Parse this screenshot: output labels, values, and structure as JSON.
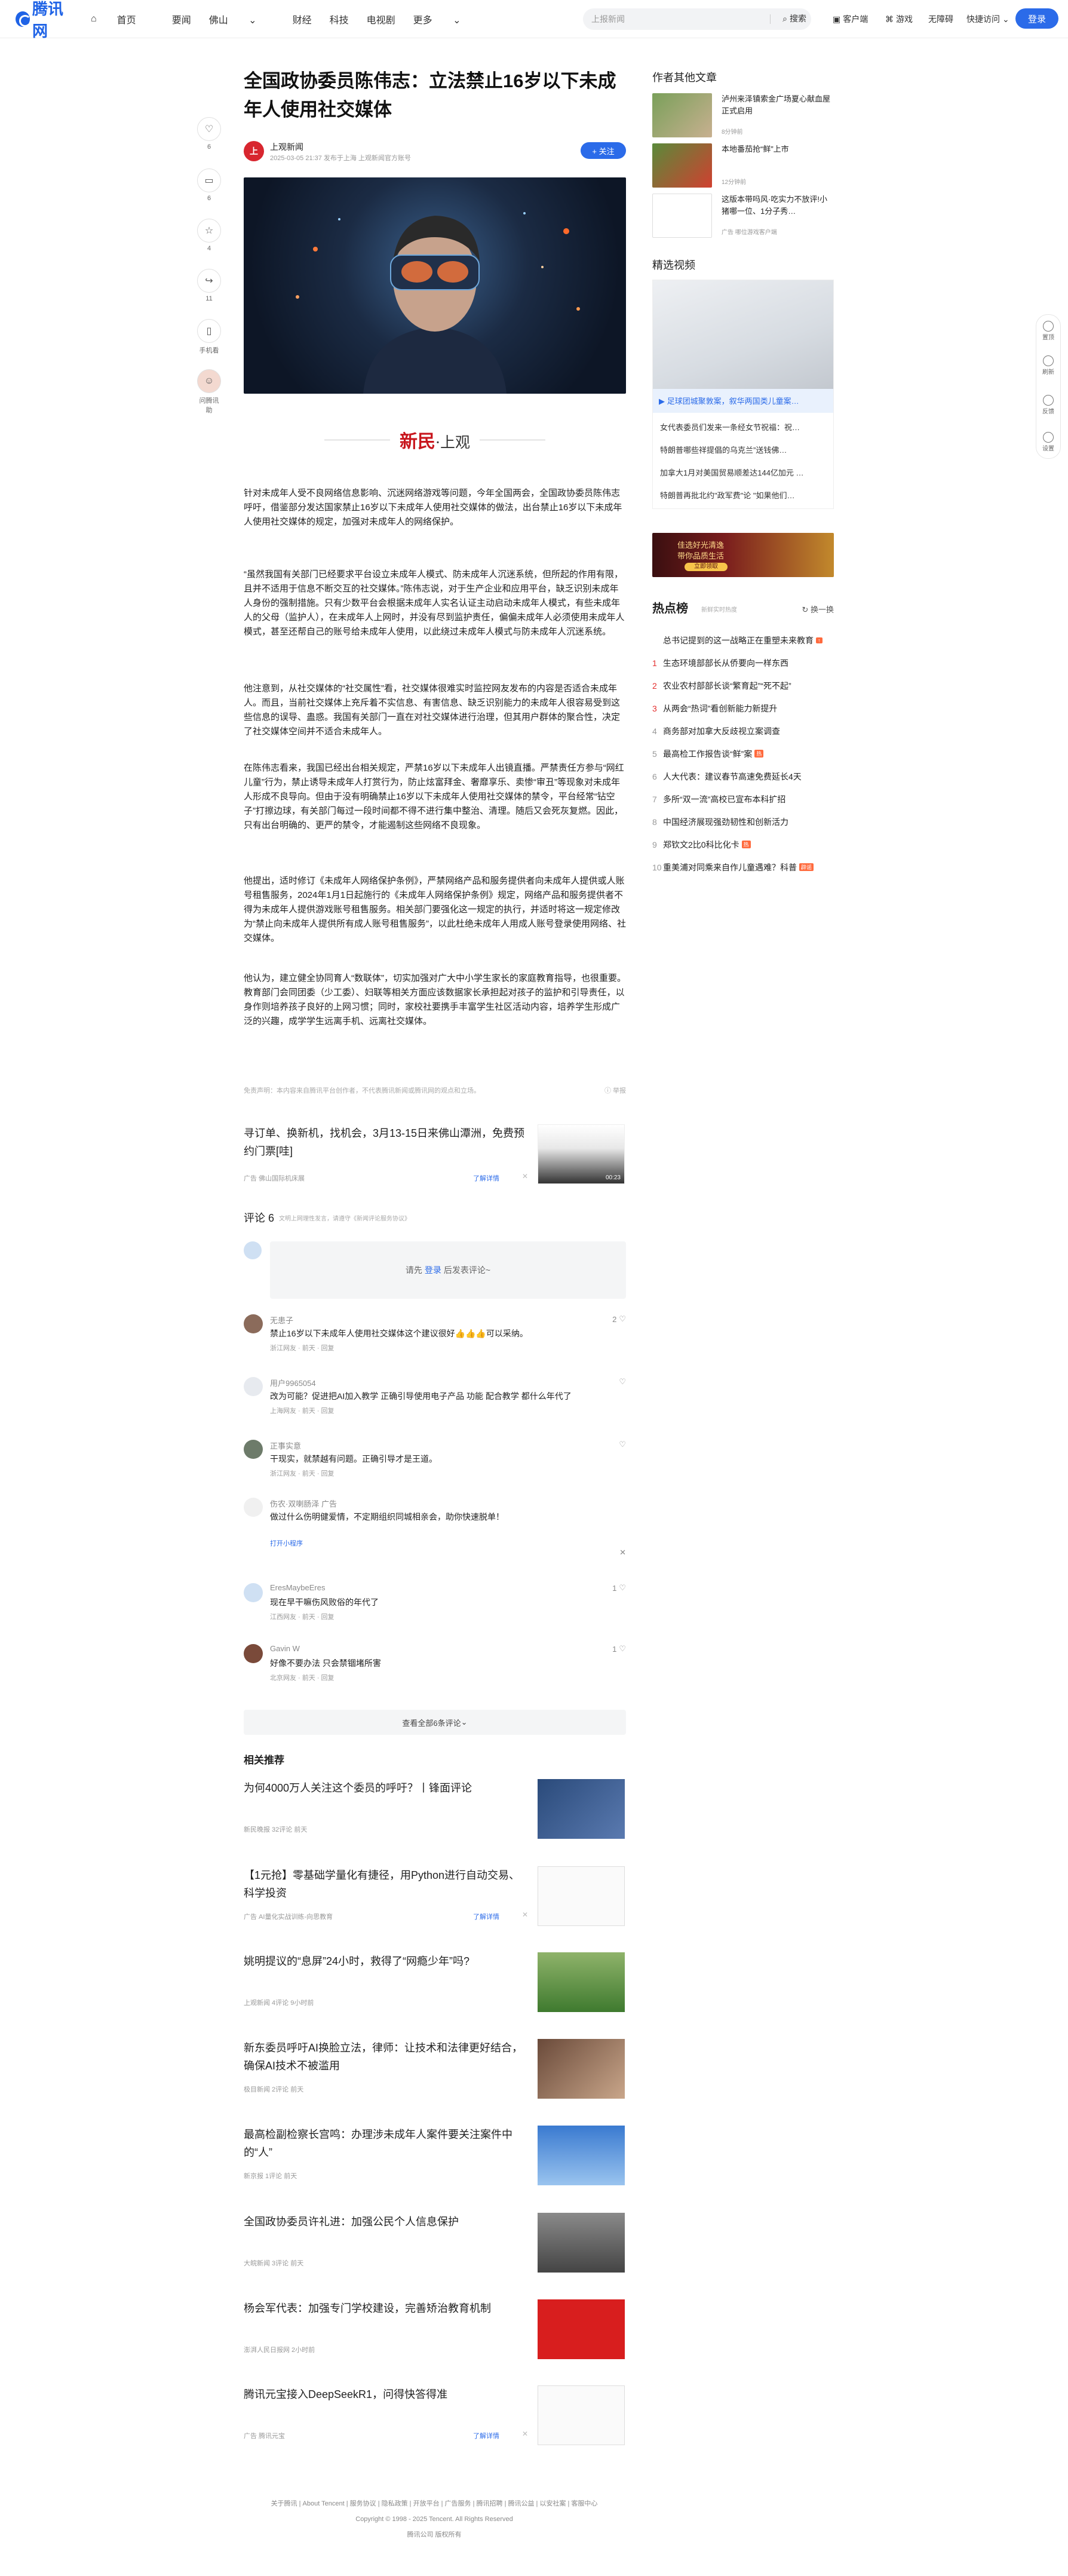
{
  "header": {
    "logo": "腾讯网",
    "nav": [
      "首页",
      "要闻",
      "佛山",
      "财经",
      "科技",
      "电视剧",
      "更多"
    ],
    "search_placeholder": "上报新闻",
    "search_btn": "搜索",
    "tools": [
      "客户端",
      "游戏",
      "无障碍",
      "快捷访问"
    ],
    "login": "登录"
  },
  "share": {
    "items": [
      {
        "icon": "heart-icon",
        "count": "6"
      },
      {
        "icon": "comment-icon",
        "count": "6"
      },
      {
        "icon": "star-icon",
        "count": "4"
      },
      {
        "icon": "share-icon",
        "count": "11"
      },
      {
        "icon": "phone-icon",
        "count": "手机看"
      },
      {
        "icon": "ai-avatar-icon",
        "count": "问腾讯助"
      }
    ]
  },
  "article": {
    "title": "全国政协委员陈伟志：立法禁止16岁以下未成年人使用社交媒体",
    "author": "上观新闻",
    "meta": "2025-03-05 21:37  发布于上海  上观新闻官方账号",
    "follow": "+ 关注",
    "brand_red": "新民",
    "brand_dot": "·上观",
    "paragraphs": [
      "针对未成年人受不良网络信息影响、沉迷网络游戏等问题，今年全国两会，全国政协委员陈伟志呼吁，借鉴部分发达国家禁止16岁以下未成年人使用社交媒体的做法，出台禁止16岁以下未成年人使用社交媒体的规定，加强对未成年人的网络保护。",
      "“虽然我国有关部门已经要求平台设立未成年人模式、防未成年人沉迷系统，但所起的作用有限，且并不适用于信息不断交互的社交媒体。”陈伟志说，对于生产企业和应用平台，缺乏识别未成年人身份的强制措施。只有少数平台会根据未成年人实名认证主动启动未成年人模式，有些未成年人的父母（监护人），在未成年人上网时，并没有尽到监护责任，偏偏未成年人必须使用未成年人模式，甚至还帮自己的账号给未成年人使用，以此绕过未成年人模式与防未成年人沉迷系统。",
      "他注意到，从社交媒体的“社交属性”看，社交媒体很难实时监控网友发布的内容是否适合未成年人。而且，当前社交媒体上充斥着不实信息、有害信息、缺乏识别能力的未成年人很容易受到这些信息的误导、蛊惑。我国有关部门一直在对社交媒体进行治理，但其用户群体的聚合性，决定了社交媒体空间并不适合未成年人。",
      "在陈伟志看来，我国已经出台相关规定，严禁16岁以下未成年人出镜直播。严禁责任方参与“网红儿童”行为，禁止诱导未成年人打赏行为，防止炫富拜金、奢靡享乐、卖惨“审丑”等现象对未成年人形成不良导向。但由于没有明确禁止16岁以下未成年人使用社交媒体的禁令，平台经常“钻空子”打擦边球，有关部门每过一段时间都不得不进行集中整治、清理。随后又会死灰复燃。因此，只有出台明确的、更严的禁令，才能遏制这些网络不良现象。",
      "他提出，适时修订《未成年人网络保护条例》，严禁网络产品和服务提供者向未成年人提供或人账号租售服务，2024年1月1日起施行的《未成年人网络保护条例》规定，网络产品和服务提供者不得为未成年人提供游戏账号租售服务。相关部门要强化这一规定的执行，并适时将这一规定修改为“禁止向未成年人提供所有成人账号租售服务”，以此杜绝未成年人用成人账号登录使用网络、社交媒体。",
      "他认为，建立健全协同育人“数联体”，切实加强对广大中小学生家长的家庭教育指导，也很重要。教育部门会同团委（少工委）、妇联等相关方面应该数据家长承担起对孩子的监护和引导责任，以身作则培养孩子良好的上网习惯；同时，家校社要携手丰富学生社区活动内容，培养学生形成广泛的兴趣，成学学生远离手机、远离社交媒体。"
    ],
    "disclaimer": "免责声明：本内容来自腾讯平台创作者，不代表腾讯新闻或腾讯网的观点和立场。",
    "report": "举报"
  },
  "ad": {
    "title": "寻订单、换新机，找机会，3月13-15日来佛山潭洲，免费预约门票[哇]",
    "meta": "广告  佛山国际机床展",
    "link": "了解详情",
    "duration": "00:23"
  },
  "comments": {
    "label": "评论 6",
    "sub": "文明上网理性发言，请遵守《新闻评论服务协议》",
    "login_prompt_a": "请先",
    "login_prompt_b": "登录",
    "login_prompt_c": "后发表评论~",
    "items": [
      {
        "name": "无患子",
        "text": "禁止16岁以下未成年人使用社交媒体这个建议很好👍👍👍可以采纳。",
        "meta": "浙江网友 · 前天 · 回复",
        "likes": "2"
      },
      {
        "name": "用户9965054",
        "text": "改为可能？促进把AI加入教学 正确引导使用电子产品 功能 配合教学 都什么年代了",
        "meta": "上海网友 · 前天 · 回复",
        "likes": ""
      },
      {
        "name": "正事实意",
        "text": "干现实，就禁越有问题。正确引导才是王道。",
        "meta": "浙江网友 · 前天 · 回复",
        "likes": ""
      },
      {
        "name": "伤农·双喇肠泽  广告",
        "text": "做过什么伤明健爱情，不定期组织同城相亲会，助你快速脱单！",
        "meta": "打开小程序",
        "likes": ""
      },
      {
        "name": "EresMaybeEres",
        "text": "现在早干嘛伤风败俗的年代了",
        "meta": "江西网友 · 前天 · 回复",
        "likes": "1"
      },
      {
        "name": "Gavin W",
        "text": "好像不要办法 只会禁锢堵所害",
        "meta": "北京网友 · 前天 · 回复",
        "likes": "1"
      }
    ],
    "more": "查看全部6条评论"
  },
  "related": {
    "head": "相关推荐",
    "items": [
      {
        "title": "为何4000万人关注这个委员的呼吁？丨锋面评论",
        "meta": "新民晚报  32评论  前天",
        "ad": false
      },
      {
        "title": "【1元抢】零基础学量化有捷径，用Python进行自动交易、科学投资",
        "meta": "广告  AI量化实战训练-向思教育",
        "ad": true
      },
      {
        "title": "姚明提议的“息屏”24小时，救得了“网瘾少年”吗?",
        "meta": "上观新闻  4评论  9小时前",
        "ad": false
      },
      {
        "title": "新东委员呼吁AI换脸立法，律师：让技术和法律更好结合，确保AI技术不被滥用",
        "meta": "极目新闻  2评论  前天",
        "ad": false
      },
      {
        "title": "最高检副检察长宫鸣：办理涉未成年人案件要关注案件中的“人”",
        "meta": "新京报  1评论  前天",
        "ad": false
      },
      {
        "title": "全国政协委员许礼进：加强公民个人信息保护",
        "meta": "大皖新闻  3评论  前天",
        "ad": false
      },
      {
        "title": "杨会军代表：加强专门学校建设，完善矫治教育机制",
        "meta": "澎湃人民日报网  2小时前",
        "ad": false
      },
      {
        "title": "腾讯元宝接入DeepSeekR1，问得快答得准",
        "meta": "广告  腾讯元宝",
        "ad": true
      }
    ],
    "ad_link": "了解详情"
  },
  "footer": {
    "links": "关于腾讯 | About Tencent | 服务协议 | 隐私政策 | 开放平台 | 广告服务 | 腾讯招聘 | 腾讯公益 | 以安社案 | 客服中心",
    "copyright": "Copyright © 1998 - 2025 Tencent. All Rights Reserved",
    "record": "腾讯公司 版权所有"
  },
  "sidebar": {
    "author_head": "作者其他文章",
    "author_articles": [
      {
        "title": "泸州来泽镇索金广场夏心献血屋正式启用",
        "meta": "8分钟前"
      },
      {
        "title": "本地番茄抢“鲜”上市",
        "meta": "12分钟前"
      },
      {
        "title": "这版本带吗风·吃实力不放评!小猪哪一位、1分子秀…",
        "meta": "广告  哪位游戏客户端"
      }
    ],
    "video_head": "精选视频",
    "video_caption": "▶ 足球团城聚敦案，叙华两国类儿童案…",
    "video_list": [
      "女代表委员们发来一条经女节祝福：祝…",
      "特朗普哪些祥提倡的乌克兰”送钱佛…",
      "加拿大1月对美国贸易顺差达144亿加元 …",
      "特朗普再批北约\"政军费\"论 \"如果他们…"
    ],
    "hot_ad_l1": "佳选好光清逸",
    "hot_ad_l2": "带你品质生活",
    "hot_ad_btn": "立即领取",
    "hot_head": "热点榜",
    "hot_sub": "新鲜实时热度",
    "hot_refresh": "换一换",
    "hot_items": [
      {
        "rank": "",
        "text": "总书记提到的这一战略正在重塑未来教育",
        "tag": "↑"
      },
      {
        "rank": "1",
        "text": "生态环境部部长从侨要向一样东西",
        "tag": ""
      },
      {
        "rank": "2",
        "text": "农业农村部部长谈“繁育起”“死不起”",
        "tag": ""
      },
      {
        "rank": "3",
        "text": "从两会“热词”看创新能力新提升",
        "tag": ""
      },
      {
        "rank": "4",
        "text": "商务部对加拿大反歧视立案调查",
        "tag": ""
      },
      {
        "rank": "5",
        "text": "最高检工作报告谈“鲜”案",
        "tag": "热"
      },
      {
        "rank": "6",
        "text": "人大代表：建议春节高速免费延长4天",
        "tag": ""
      },
      {
        "rank": "7",
        "text": "多所“双一流”高校已宣布本科扩招",
        "tag": ""
      },
      {
        "rank": "8",
        "text": "中国经济展现强劲韧性和创新活力",
        "tag": ""
      },
      {
        "rank": "9",
        "text": "郑钦文2比0科比化卡",
        "tag": "热"
      },
      {
        "rank": "10",
        "text": "重美浦对同乘来自作儿童遇难？科普",
        "tag": "辟谣"
      }
    ]
  },
  "floatbar": {
    "items": [
      "置顶",
      "刷新",
      "反馈",
      "设置"
    ]
  }
}
